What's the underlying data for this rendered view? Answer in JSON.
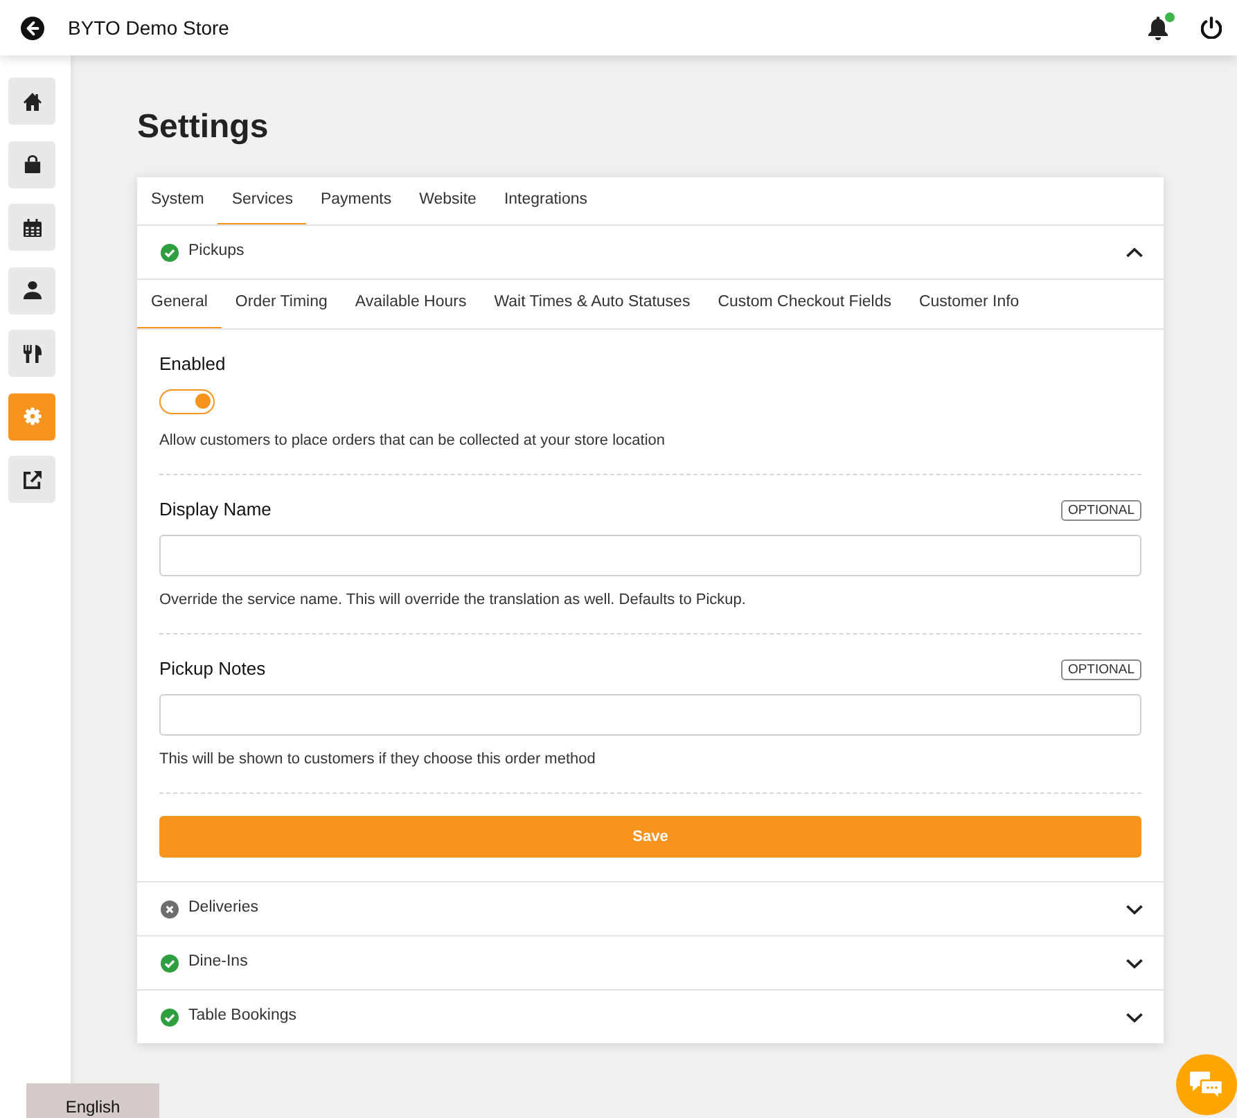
{
  "header": {
    "title": "BYTO Demo Store",
    "unread_notifications": true
  },
  "sidebar": {
    "items": [
      {
        "kind": "home",
        "selected": false
      },
      {
        "kind": "bag",
        "selected": false
      },
      {
        "kind": "calendar",
        "selected": false
      },
      {
        "kind": "user",
        "selected": false
      },
      {
        "kind": "utensils",
        "selected": false
      },
      {
        "kind": "settings",
        "selected": true
      },
      {
        "kind": "external_link",
        "selected": false
      }
    ]
  },
  "page_title": "Settings",
  "tabs": [
    {
      "label": "System",
      "selected": false
    },
    {
      "label": "Services",
      "selected": true
    },
    {
      "label": "Payments",
      "selected": false
    },
    {
      "label": "Website",
      "selected": false
    },
    {
      "label": "Integrations",
      "selected": false
    }
  ],
  "services": [
    {
      "name": "Pickups",
      "enabled": true,
      "expanded": true,
      "subtabs": [
        {
          "label": "General",
          "selected": true
        },
        {
          "label": "Order Timing",
          "selected": false
        },
        {
          "label": "Available Hours",
          "selected": false
        },
        {
          "label": "Wait Times & Auto Statuses",
          "selected": false
        },
        {
          "label": "Custom Checkout Fields",
          "selected": false
        },
        {
          "label": "Customer Info",
          "selected": false
        }
      ],
      "fields": [
        {
          "kind": "toggle",
          "label": "Enabled",
          "on": true,
          "help": "Allow customers to place orders that can be collected at your store location"
        },
        {
          "kind": "text",
          "label": "Display Name",
          "badge": "OPTIONAL",
          "help": "Override the service name. This will override the translation as well. Defaults to Pickup."
        },
        {
          "kind": "text",
          "label": "Pickup Notes",
          "badge": "OPTIONAL",
          "help": "This will be shown to customers if they choose this order method"
        }
      ],
      "save_label": "Save"
    },
    {
      "name": "Deliveries",
      "enabled": false,
      "expanded": false
    },
    {
      "name": "Dine-Ins",
      "enabled": true,
      "expanded": false
    },
    {
      "name": "Table Bookings",
      "enabled": true,
      "expanded": false
    }
  ],
  "language": "English"
}
